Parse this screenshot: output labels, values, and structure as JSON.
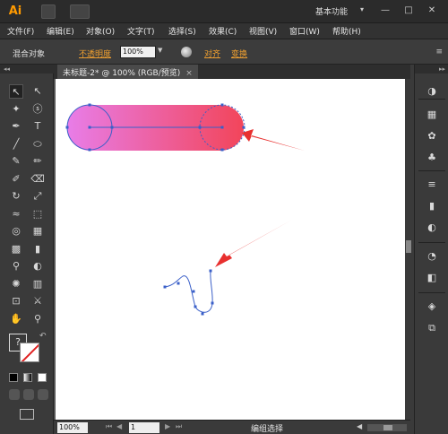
{
  "app": {
    "logo": "Ai",
    "workspace": "基本功能",
    "workspace_arrow": "▾"
  },
  "window_controls": {
    "minimize": "—",
    "maximize": "□",
    "close": "✕"
  },
  "menu": [
    "文件(F)",
    "编辑(E)",
    "对象(O)",
    "文字(T)",
    "选择(S)",
    "效果(C)",
    "视图(V)",
    "窗口(W)",
    "帮助(H)"
  ],
  "control_bar": {
    "object_label": "混合对象",
    "opacity_link": "不透明度",
    "opacity_value": "100%",
    "align_link": "对齐",
    "transform_link": "变换",
    "menu_icon": "≡"
  },
  "document": {
    "tab_title": "未标题-2* @ 100% (RGB/预览)",
    "close": "×"
  },
  "status": {
    "zoom": "100%",
    "page": "1",
    "text": "编组选择"
  },
  "toolbox": {
    "collapse": "◂◂",
    "tools": [
      {
        "name": "selection-tool",
        "glyph": "↖"
      },
      {
        "name": "direct-selection-tool",
        "glyph": "↖"
      },
      {
        "name": "magic-wand-tool",
        "glyph": "✦"
      },
      {
        "name": "lasso-tool",
        "glyph": "ⓢ"
      },
      {
        "name": "pen-tool",
        "glyph": "✒"
      },
      {
        "name": "type-tool",
        "glyph": "T"
      },
      {
        "name": "line-tool",
        "glyph": "╱"
      },
      {
        "name": "ellipse-tool",
        "glyph": "⬭"
      },
      {
        "name": "paintbrush-tool",
        "glyph": "✎"
      },
      {
        "name": "pencil-tool",
        "glyph": "✏"
      },
      {
        "name": "blob-brush-tool",
        "glyph": "✐"
      },
      {
        "name": "eraser-tool",
        "glyph": "⌫"
      },
      {
        "name": "rotate-tool",
        "glyph": "↻"
      },
      {
        "name": "scale-tool",
        "glyph": "⤢"
      },
      {
        "name": "width-tool",
        "glyph": "≈"
      },
      {
        "name": "free-transform-tool",
        "glyph": "⬚"
      },
      {
        "name": "shape-builder-tool",
        "glyph": "◎"
      },
      {
        "name": "perspective-grid-tool",
        "glyph": "▦"
      },
      {
        "name": "mesh-tool",
        "glyph": "▩"
      },
      {
        "name": "gradient-tool",
        "glyph": "▮"
      },
      {
        "name": "eyedropper-tool",
        "glyph": "⚲"
      },
      {
        "name": "blend-tool",
        "glyph": "◐"
      },
      {
        "name": "symbol-sprayer-tool",
        "glyph": "✺"
      },
      {
        "name": "column-graph-tool",
        "glyph": "▥"
      },
      {
        "name": "artboard-tool",
        "glyph": "⊡"
      },
      {
        "name": "slice-tool",
        "glyph": "⚔"
      },
      {
        "name": "hand-tool",
        "glyph": "✋"
      },
      {
        "name": "zoom-tool",
        "glyph": "⚲"
      }
    ],
    "fill_label": "?",
    "swap_icon": "↶"
  },
  "right_panel": {
    "collapse": "▸▸",
    "icons": [
      "color-icon",
      "swatches-icon",
      "brushes-icon",
      "symbols-icon",
      "stroke-icon",
      "gradient-icon",
      "transparency-icon",
      "appearance-icon",
      "graphic-styles-icon",
      "layers-icon",
      "artboards-icon"
    ]
  },
  "colors": {
    "gradient_start": "#e87de8",
    "gradient_end": "#f2455a",
    "arrow": "#e8302f",
    "anchor": "#3a5fc8",
    "accent_link": "#f0a030"
  }
}
